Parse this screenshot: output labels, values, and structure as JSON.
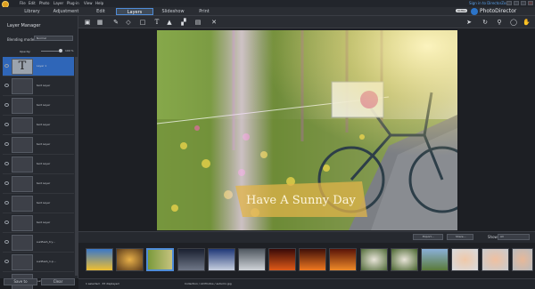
{
  "menubar": {
    "items": [
      "File",
      "Edit",
      "Photo",
      "Layer",
      "Plug-in",
      "View",
      "Help"
    ],
    "signin": "Sign in to DirectorZone"
  },
  "tabs": {
    "library": "Library",
    "adjustment": "Adjustment",
    "edit": "Edit",
    "layers": "Layers",
    "slideshow": "Slideshow",
    "print": "Print"
  },
  "brand": {
    "name": "PhotoDirector",
    "badge": "ULTRA",
    "accent": "#4f8cd8"
  },
  "layer_manager": {
    "title": "Layer Manager",
    "blending_label": "Blending mode:",
    "blending_value": "Normal",
    "opacity_label": "Opacity:",
    "opacity_value": "100 %",
    "opacity_fraction": 1.0,
    "layers": [
      {
        "name": "Layer 1",
        "selected": true,
        "thumb": "T"
      },
      {
        "name": "text Layer",
        "selected": false,
        "thumb": ""
      },
      {
        "name": "text Layer",
        "selected": false,
        "thumb": ""
      },
      {
        "name": "text Layer",
        "selected": false,
        "thumb": ""
      },
      {
        "name": "text Layer",
        "selected": false,
        "thumb": ""
      },
      {
        "name": "text Layer",
        "selected": false,
        "thumb": ""
      },
      {
        "name": "text Layer",
        "selected": false,
        "thumb": ""
      },
      {
        "name": "text Layer",
        "selected": false,
        "thumb": ""
      },
      {
        "name": "text Layer",
        "selected": false,
        "thumb": ""
      },
      {
        "name": "sunflash_try...",
        "selected": false,
        "thumb": ""
      },
      {
        "name": "sunflash_1.p...",
        "selected": false,
        "thumb": ""
      },
      {
        "name": "sunflash_2.p...",
        "selected": false,
        "thumb": ""
      }
    ],
    "save_label": "Save to",
    "clear_label": "Clear"
  },
  "photo": {
    "caption": "Have A Sunny Day"
  },
  "filmbar": {
    "export_label": "Export...",
    "share_label": "Share...",
    "show_label": "Show:",
    "show_value": "All"
  },
  "status": {
    "count": "1 selected  ·  33 displayed",
    "path": "Collection / All Photos / autumn.jpg"
  }
}
